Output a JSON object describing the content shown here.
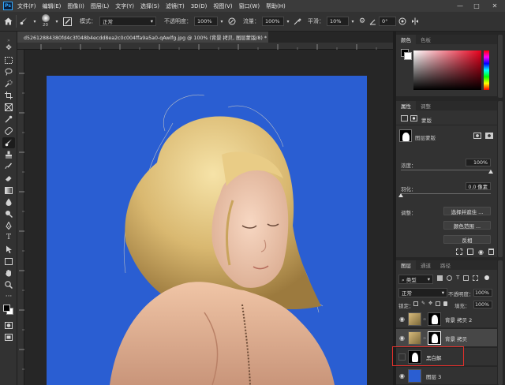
{
  "app": {
    "logo": "Ps"
  },
  "menubar": {
    "items": [
      "文件(F)",
      "编辑(E)",
      "图像(I)",
      "图层(L)",
      "文字(Y)",
      "选择(S)",
      "滤镜(T)",
      "3D(D)",
      "视图(V)",
      "窗口(W)",
      "帮助(H)"
    ]
  },
  "window_controls": {
    "minimize": "—",
    "maximize": "□",
    "close": "✕"
  },
  "options_bar": {
    "brush_size": "20",
    "mode_label": "模式：",
    "mode_value": "正常",
    "opacity_label": "不透明度：",
    "opacity_value": "100%",
    "flow_label": "流量：",
    "flow_value": "100%",
    "smoothing_label": "平滑：",
    "smoothing_value": "10%",
    "angle_value": "0°"
  },
  "document": {
    "tab_title": "d52612884380fd4c3f048b4ecdd8ea2c0c004ffa9a5a0-qAwlfg.jpg @ 100% (背景 拷贝, 图层蒙版/8) *",
    "close": "×"
  },
  "color_panel": {
    "tab1": "颜色",
    "tab2": "色板"
  },
  "properties_panel": {
    "tab1": "属性",
    "tab2": "调整",
    "section": "蒙版",
    "mask_label": "图层蒙版",
    "density_label": "浓度：",
    "density_value": "100%",
    "feather_label": "羽化：",
    "feather_value": "0.0 像素",
    "adjust_label": "调整：",
    "select_mask_button": "选择并遮住 ...",
    "color_range_button": "颜色范围 ...",
    "invert_button": "反相"
  },
  "layers_panel": {
    "tab1": "图层",
    "tab2": "通道",
    "tab3": "路径",
    "filter_label": "类型",
    "blend_mode": "正常",
    "opacity_label": "不透明度：",
    "opacity_value": "100%",
    "lock_label": "锁定：",
    "fill_label": "填充：",
    "fill_value": "100%",
    "layers": [
      {
        "name": "背景 拷贝 2"
      },
      {
        "name": "背景 拷贝"
      },
      {
        "name": "黑白解"
      },
      {
        "name": "图层 3"
      }
    ]
  },
  "colors": {
    "canvas_blue": "#2a5ed2",
    "highlight_red": "#e0302b",
    "accent": "#31a8ff"
  }
}
